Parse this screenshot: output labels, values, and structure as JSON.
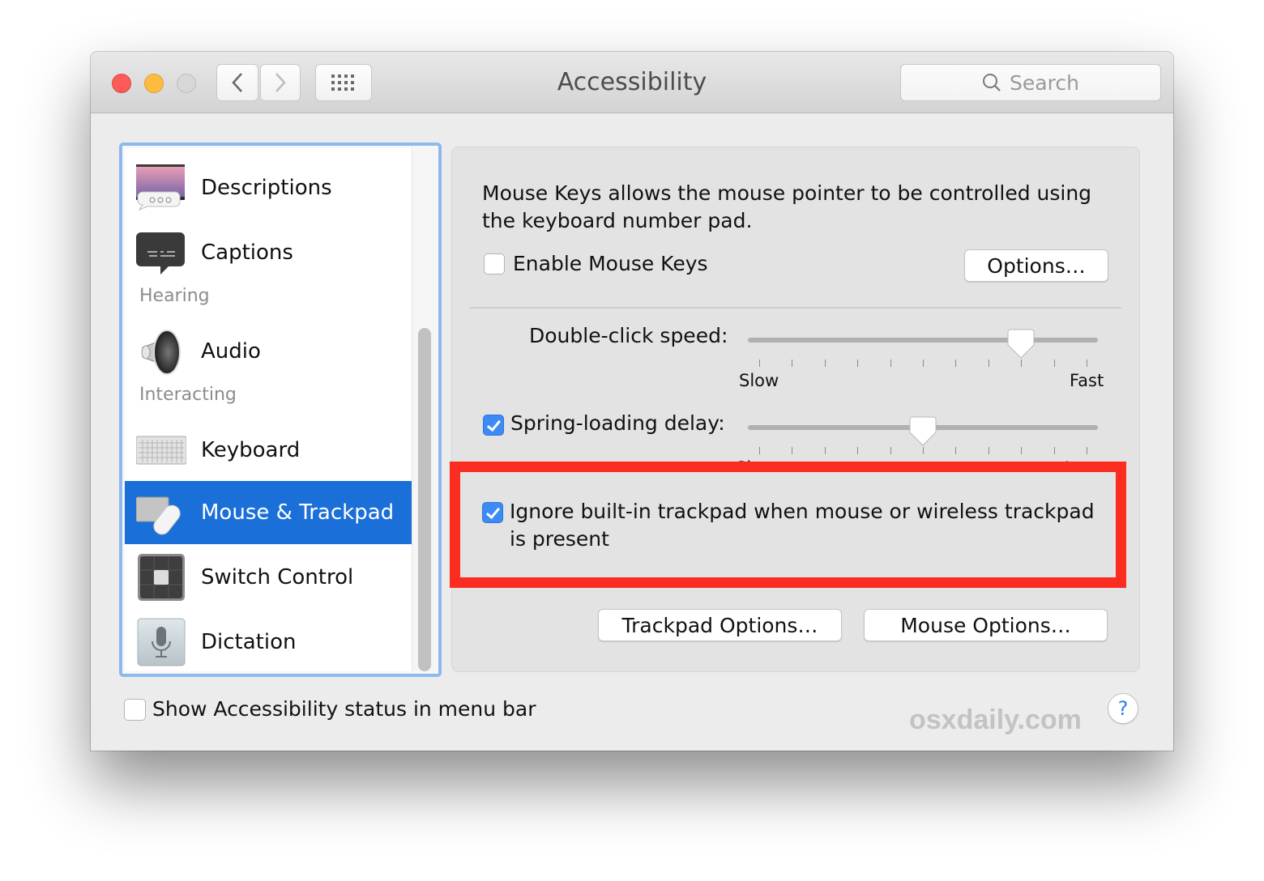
{
  "window": {
    "title": "Accessibility",
    "search": {
      "placeholder": "Search",
      "value": ""
    }
  },
  "sidebar": {
    "items": [
      {
        "label": "Descriptions",
        "icon": "descriptions-icon",
        "selected": false
      },
      {
        "label": "Captions",
        "icon": "captions-icon",
        "selected": false
      },
      {
        "section": "Hearing"
      },
      {
        "label": "Audio",
        "icon": "speaker-icon",
        "selected": false
      },
      {
        "section": "Interacting"
      },
      {
        "label": "Keyboard",
        "icon": "keyboard-icon",
        "selected": false
      },
      {
        "label": "Mouse & Trackpad",
        "icon": "mouse-trackpad-icon",
        "selected": true
      },
      {
        "label": "Switch Control",
        "icon": "switch-control-icon",
        "selected": false
      },
      {
        "label": "Dictation",
        "icon": "microphone-icon",
        "selected": false
      }
    ],
    "sections": {
      "hearing": "Hearing",
      "interacting": "Interacting"
    }
  },
  "panel": {
    "description": "Mouse Keys allows the mouse pointer to be controlled using the keyboard number pad.",
    "enable_mouse_keys": {
      "label": "Enable Mouse Keys",
      "checked": false
    },
    "options_button": "Options…",
    "double_click": {
      "label": "Double-click speed:",
      "min_label": "Slow",
      "max_label": "Fast",
      "value": 0.8,
      "ticks": 11
    },
    "spring_loading": {
      "label": "Spring-loading delay:",
      "checked": true,
      "min_label": "Short",
      "max_label": "Long",
      "value": 0.5,
      "ticks": 11
    },
    "ignore_trackpad": {
      "label": "Ignore built-in trackpad when mouse or wireless trackpad is present",
      "checked": true
    },
    "trackpad_options_button": "Trackpad Options…",
    "mouse_options_button": "Mouse Options…"
  },
  "footer": {
    "show_status": {
      "label": "Show Accessibility status in menu bar",
      "checked": false
    },
    "watermark": "osxdaily.com",
    "help": "?"
  },
  "colors": {
    "selection": "#1a6fd8",
    "checkbox_checked": "#3b8af5",
    "highlight_box": "#fb2c20",
    "focus_ring": "#8fb9ee"
  }
}
